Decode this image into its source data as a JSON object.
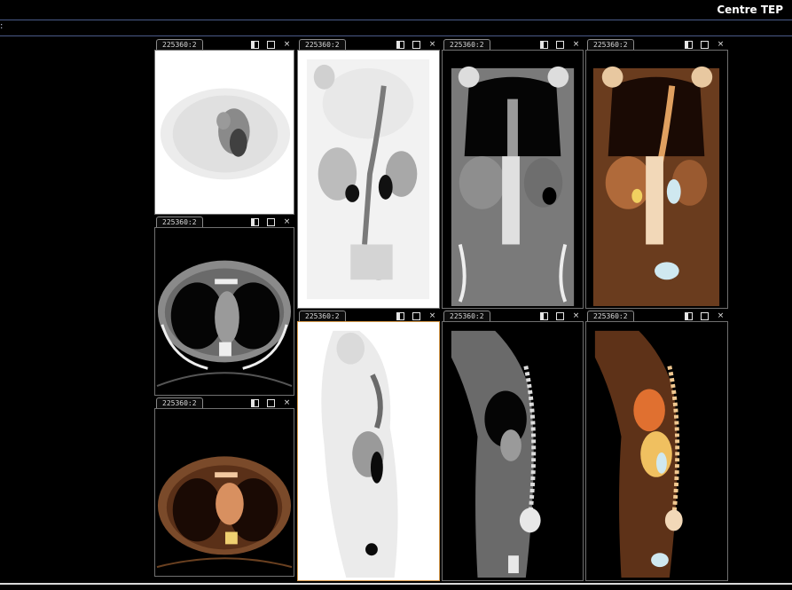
{
  "app": {
    "title": "Centre TEP",
    "top_marker": ":"
  },
  "series_label": "225360:2",
  "viewports": [
    {
      "id": "pet-axial",
      "label": "225360:2",
      "modality": "PET",
      "plane": "axial"
    },
    {
      "id": "pet-coronal",
      "label": "225360:2",
      "modality": "PET",
      "plane": "coronal"
    },
    {
      "id": "ct-coronal",
      "label": "225360:2",
      "modality": "CT",
      "plane": "coronal"
    },
    {
      "id": "fusion-coronal",
      "label": "225360:2",
      "modality": "PET/CT",
      "plane": "coronal"
    },
    {
      "id": "ct-axial",
      "label": "225360:2",
      "modality": "CT",
      "plane": "axial"
    },
    {
      "id": "pet-sagittal",
      "label": "225360:2",
      "modality": "PET",
      "plane": "sagittal"
    },
    {
      "id": "ct-sagittal",
      "label": "225360:2",
      "modality": "CT",
      "plane": "sagittal"
    },
    {
      "id": "fusion-sagittal",
      "label": "225360:2",
      "modality": "PET/CT",
      "plane": "sagittal"
    },
    {
      "id": "fusion-axial",
      "label": "225360:2",
      "modality": "PET/CT",
      "plane": "axial"
    }
  ],
  "controls": {
    "restore_icon": "restore-icon",
    "maximize_icon": "maximize-icon",
    "close_icon": "close-icon",
    "close_glyph": "×"
  },
  "colors": {
    "background": "#000000",
    "separator": "#4a5a88",
    "selected_border": "#d89a4a",
    "fusion_tint": "#c07030"
  }
}
